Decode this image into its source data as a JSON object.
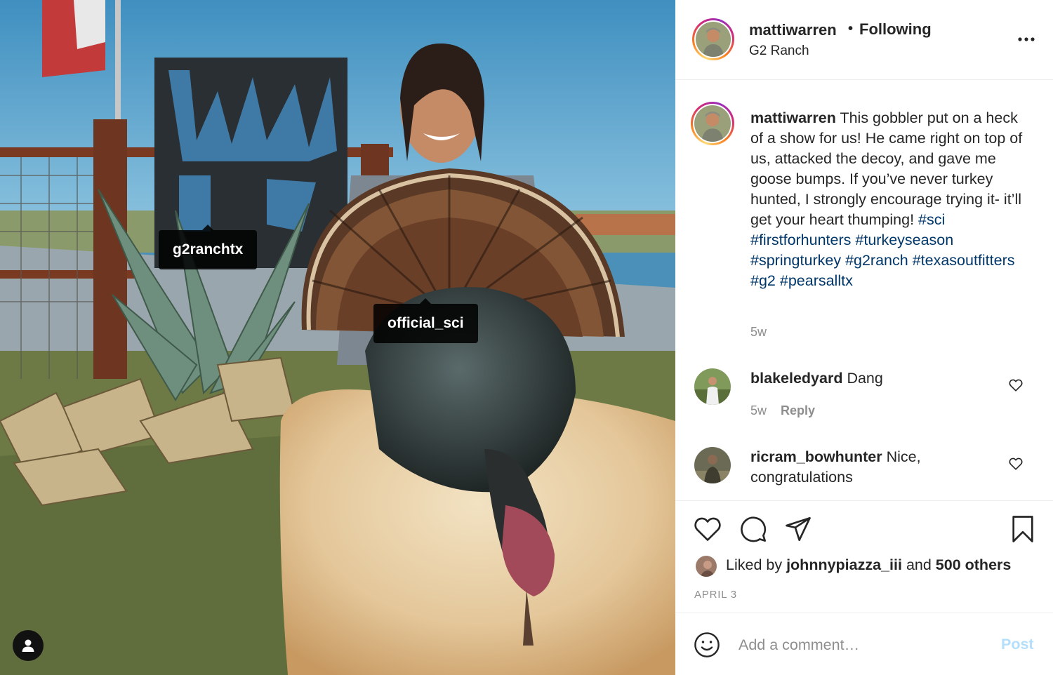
{
  "photo": {
    "tags": [
      "g2ranchtx",
      "official_sci"
    ]
  },
  "post": {
    "username": "mattiwarren",
    "follow_separator": "•",
    "follow_status": "Following",
    "location": "G2 Ranch",
    "caption_username": "mattiwarren",
    "caption_text": "This gobbler put on a heck of a show for us! He came right on top of us, attacked the decoy, and gave me goose bumps. If you’ve never turkey hunted, I strongly encourage trying it- it’ll get your heart thumping!",
    "hashtags": [
      "#sci",
      "#firstforhunters",
      "#turkeyseason",
      "#springturkey",
      "#g2ranch",
      "#texasoutfitters",
      "#g2",
      "#pearsalltx"
    ],
    "caption_time": "5w"
  },
  "comments": [
    {
      "username": "blakeledyard",
      "text": "Dang",
      "time": "5w",
      "reply_label": "Reply"
    },
    {
      "username": "ricram_bowhunter",
      "text": "Nice, congratulations"
    }
  ],
  "likes": {
    "prefix": "Liked by",
    "user": "johnnypiazza_iii",
    "and": "and",
    "others": "500 others"
  },
  "date": "APRIL 3",
  "composer": {
    "placeholder": "Add a comment…",
    "post_label": "Post"
  },
  "colors": {
    "hashtag": "#00376b",
    "muted": "#8e8e8e",
    "post_disabled": "#b2dffc"
  }
}
